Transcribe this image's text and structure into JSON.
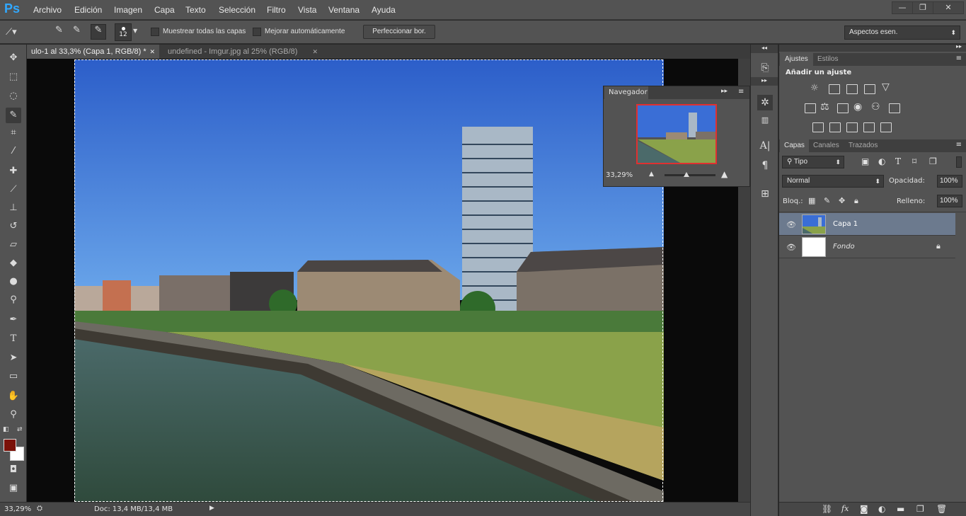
{
  "app": {
    "logo": "Ps"
  },
  "menu": [
    "Archivo",
    "Edición",
    "Imagen",
    "Capa",
    "Texto",
    "Selección",
    "Filtro",
    "Vista",
    "Ventana",
    "Ayuda"
  ],
  "window_controls": {
    "minimize": "—",
    "restore": "❐",
    "close": "✕"
  },
  "options": {
    "brush_size": "12",
    "sample_all_label": "Muestrear todas las capas",
    "auto_enhance_label": "Mejorar automáticamente",
    "refine_edge_label": "Perfeccionar bor.",
    "workspace": "Aspectos esen."
  },
  "tabs": [
    {
      "label": "ulo-1 al 33,3% (Capa 1, RGB/8) *",
      "active": true
    },
    {
      "label": "undefined - Imgur.jpg al 25% (RGB/8)",
      "active": false
    }
  ],
  "navigator": {
    "title": "Navegador",
    "zoom": "33,29%"
  },
  "status": {
    "zoom": "33,29%",
    "doc": "Doc: 13,4 MB/13,4 MB"
  },
  "adjustments": {
    "tabs": [
      "Ajustes",
      "Estilos"
    ],
    "heading": "Añadir un ajuste"
  },
  "layers_panel": {
    "tabs": [
      "Capas",
      "Canales",
      "Trazados"
    ],
    "filter": "Tipo",
    "blend_mode": "Normal",
    "opacity_label": "Opacidad:",
    "opacity_value": "100%",
    "lock_label": "Bloq.:",
    "fill_label": "Relleno:",
    "fill_value": "100%",
    "layers": [
      {
        "name": "Capa 1",
        "selected": true
      },
      {
        "name": "Fondo",
        "selected": false
      }
    ]
  },
  "colors": {
    "foreground": "#7a1108",
    "background": "#ffffff",
    "accent": "#31a8ff"
  }
}
